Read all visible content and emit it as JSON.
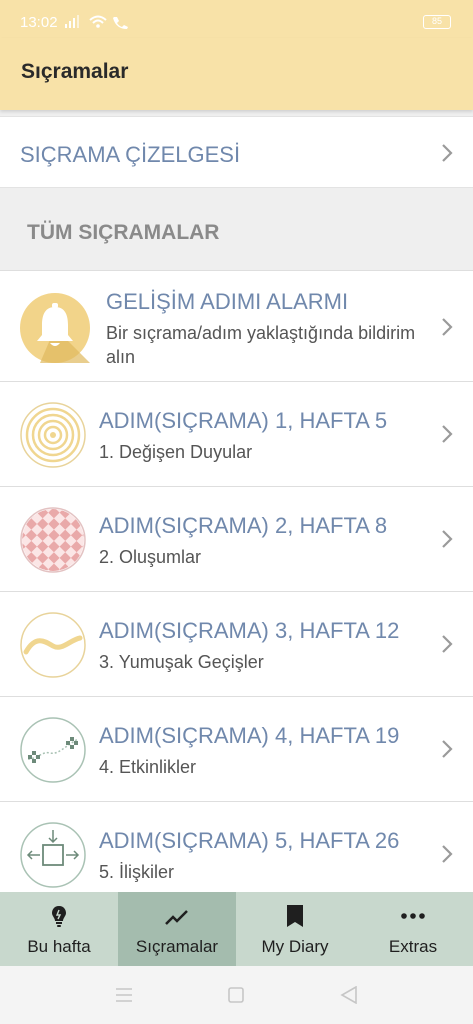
{
  "status_bar": {
    "time": "13:02",
    "battery": "85"
  },
  "app_bar": {
    "title": "Sıçramalar"
  },
  "chart_row": {
    "label": "SIÇRAMA ÇİZELGESİ"
  },
  "section": {
    "header": "TÜM SIÇRAMALAR"
  },
  "alarm": {
    "title": "GELİŞİM ADIMI ALARMI",
    "subtitle": "Bir sıçrama/adım yaklaştığında bildirim alın",
    "icon": "bell-icon"
  },
  "leaps": [
    {
      "title": "ADIM(SIÇRAMA) 1, HAFTA 5",
      "subtitle": "1. Değişen Duyular",
      "icon": "spiral-icon"
    },
    {
      "title": "ADIM(SIÇRAMA) 2, HAFTA 8",
      "subtitle": "2. Oluşumlar",
      "icon": "checker-icon"
    },
    {
      "title": "ADIM(SIÇRAMA) 3, HAFTA 12",
      "subtitle": "3. Yumuşak Geçişler",
      "icon": "wave-icon"
    },
    {
      "title": "ADIM(SIÇRAMA) 4, HAFTA 19",
      "subtitle": "4. Etkinlikler",
      "icon": "events-icon"
    },
    {
      "title": "ADIM(SIÇRAMA) 5, HAFTA 26",
      "subtitle": "5. İlişkiler",
      "icon": "relations-icon"
    }
  ],
  "nav": {
    "tabs": [
      {
        "label": "Bu hafta",
        "icon": "lightbulb-icon"
      },
      {
        "label": "Sıçramalar",
        "icon": "trend-icon",
        "active": true
      },
      {
        "label": "My Diary",
        "icon": "bookmark-icon"
      },
      {
        "label": "Extras",
        "icon": "more-icon"
      }
    ]
  },
  "colors": {
    "header_bg": "#f8e2a8",
    "title_blue": "#7088ac",
    "nav_bg": "#c8d8cd",
    "nav_active": "#a4bcae"
  }
}
